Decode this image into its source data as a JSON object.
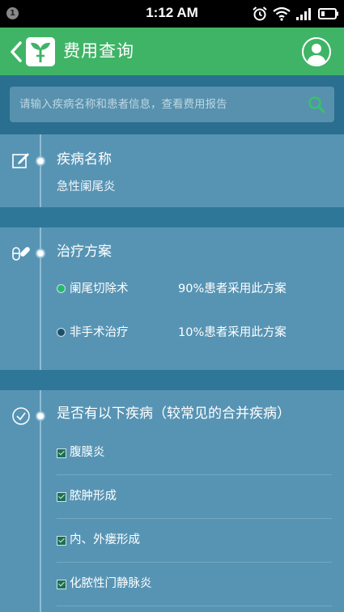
{
  "statusbar": {
    "time": "1:12 AM",
    "notification_badge": "1"
  },
  "appbar": {
    "title": "费用查询",
    "accent": "#3fb466"
  },
  "search": {
    "placeholder": "请输入疾病名称和患者信息，查看费用报告"
  },
  "disease": {
    "title": "疾病名称",
    "value": "急性阑尾炎"
  },
  "treatment": {
    "title": "治疗方案",
    "plans": [
      {
        "name": "阑尾切除术",
        "percent": "90%患者采用此方案",
        "selected": true
      },
      {
        "name": "非手术治疗",
        "percent": "10%患者采用此方案",
        "selected": false
      }
    ]
  },
  "conditions": {
    "title": "是否有以下疾病（较常见的合并疾病）",
    "items": [
      {
        "label": "腹膜炎",
        "checked": true
      },
      {
        "label": "脓肿形成",
        "checked": true
      },
      {
        "label": "内、外瘘形成",
        "checked": true
      },
      {
        "label": "化脓性门静脉炎",
        "checked": true
      }
    ]
  }
}
